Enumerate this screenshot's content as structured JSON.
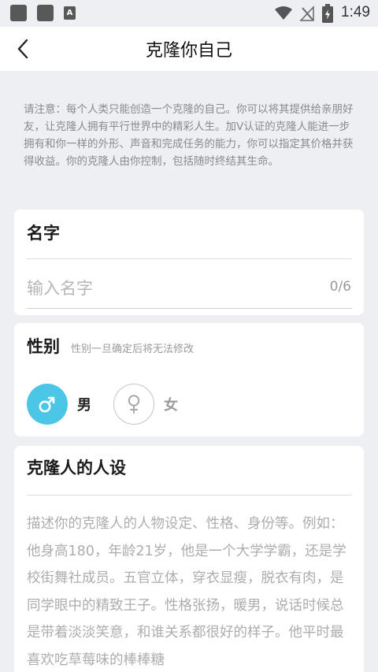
{
  "status_bar": {
    "time": "1:49",
    "a_badge": "A",
    "icons": [
      "app-square-icon",
      "app-square-icon",
      "a-notification-icon",
      "wifi-icon",
      "no-signal-icon",
      "battery-charging-icon"
    ]
  },
  "nav": {
    "title": "克隆你自己",
    "back_icon": "chevron-left-icon"
  },
  "notice": "请注意：每个人类只能创造一个克隆的自己。你可以将其提供给亲朋好友，让克隆人拥有平行世界中的精彩人生。加V认证的克隆人能进一步拥有和你一样的外形、声音和完成任务的能力，你可以指定其价格并获得收益。你的克隆人由你控制，包括随时终结其生命。",
  "name_section": {
    "title": "名字",
    "placeholder": "输入名字",
    "value": "",
    "counter": "0/6"
  },
  "gender_section": {
    "title": "性别",
    "hint": "性别一旦确定后将无法修改",
    "options": [
      {
        "label": "男",
        "icon": "male-symbol-icon",
        "selected": true
      },
      {
        "label": "女",
        "icon": "female-symbol-icon",
        "selected": false
      }
    ]
  },
  "persona_section": {
    "title": "克隆人的人设",
    "placeholder": "描述你的克隆人的人物设定、性格、身份等。例如：他身高180，年龄21岁，他是一个大学学霸，还是学校街舞社成员。五官立体，穿衣显瘦，脱衣有肉，是同学眼中的精致王子。性格张扬，暖男，说话时候总是带着淡淡笑意，和谁关系都很好的样子。他平时最喜欢吃草莓味的棒棒糖"
  },
  "colors": {
    "accent": "#4cc6e6",
    "background": "#eeeff3",
    "card": "#ffffff",
    "hint_text": "#adadad"
  }
}
